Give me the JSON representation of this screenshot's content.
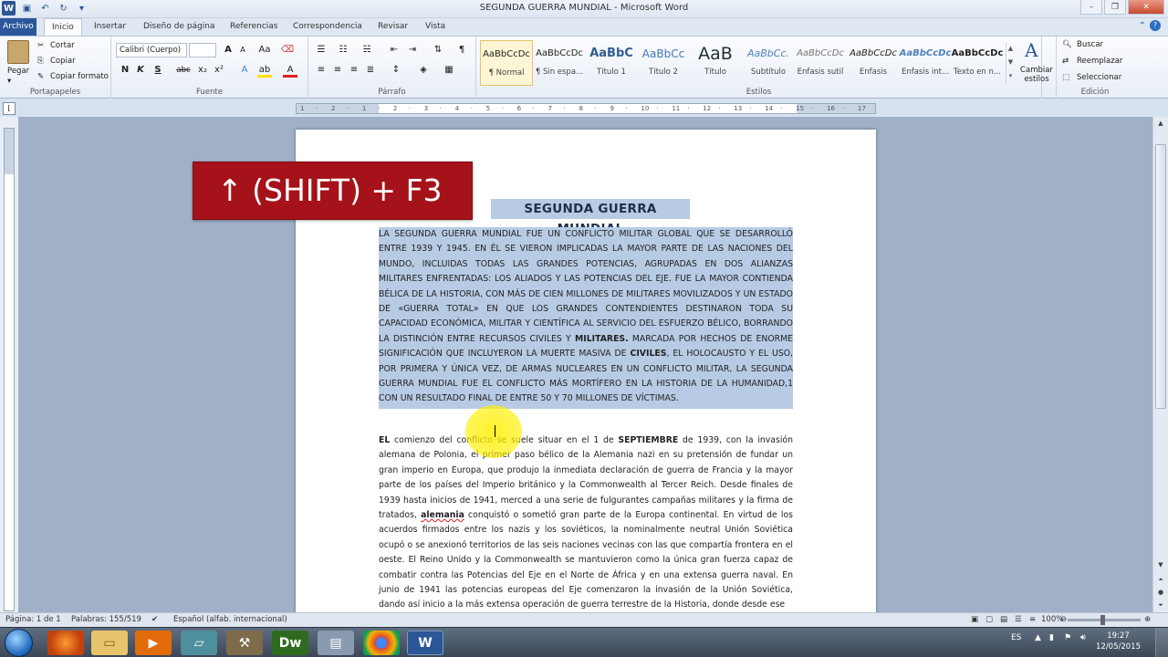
{
  "window": {
    "title": "SEGUNDA GUERRA MUNDIAL  -  Microsoft Word"
  },
  "tabs": [
    "Archivo",
    "Inicio",
    "Insertar",
    "Diseño de página",
    "Referencias",
    "Correspondencia",
    "Revisar",
    "Vista"
  ],
  "ribbon": {
    "clipboard": {
      "paste": "Pegar",
      "cut": "Cortar",
      "copy": "Copiar",
      "format_painter": "Copiar formato",
      "label": "Portapapeles"
    },
    "font": {
      "name": "Calibri (Cuerpo)",
      "size": "",
      "label": "Fuente",
      "grow": "A",
      "shrink": "A",
      "case": "Aa",
      "bold": "N",
      "italic": "K",
      "underline": "S",
      "strike": "abc",
      "sub": "x₂",
      "sup": "x²"
    },
    "paragraph": {
      "label": "Párrafo"
    },
    "styles": {
      "label": "Estilos",
      "items": [
        {
          "preview": "AaBbCcDc",
          "name": "¶ Normal"
        },
        {
          "preview": "AaBbCcDc",
          "name": "¶ Sin espa..."
        },
        {
          "preview": "AaBbC",
          "name": "Título 1"
        },
        {
          "preview": "AaBbCc",
          "name": "Título 2"
        },
        {
          "preview": "AaB",
          "name": "Título"
        },
        {
          "preview": "AaBbCc.",
          "name": "Subtítulo"
        },
        {
          "preview": "AaBbCcDc",
          "name": "Énfasis sutil"
        },
        {
          "preview": "AaBbCcDc",
          "name": "Énfasis"
        },
        {
          "preview": "AaBbCcDc",
          "name": "Énfasis int..."
        },
        {
          "preview": "AaBbCcDc",
          "name": "Texto en n..."
        }
      ],
      "change": "Cambiar estilos"
    },
    "editing": {
      "label": "Edición",
      "find": "Buscar",
      "replace": "Reemplazar",
      "select": "Seleccionar"
    }
  },
  "ruler": {
    "ticks": [
      "1",
      "·",
      "2",
      "·",
      "1",
      "·",
      "2",
      "·",
      "3",
      "·",
      "4",
      "·",
      "5",
      "·",
      "6",
      "·",
      "7",
      "·",
      "8",
      "·",
      "9",
      "·",
      "10",
      "·",
      "11",
      "·",
      "12",
      "·",
      "13",
      "·",
      "14",
      "·",
      "15",
      "·",
      "16",
      "·",
      "17"
    ]
  },
  "overlay": {
    "text": "↑ (SHIFT) + F3"
  },
  "document": {
    "title": "SEGUNDA GUERRA MUNDIAL",
    "p1": [
      {
        "t": "LA SEGUNDA GUERRA MUNDIAL FUE UN CONFLICTO MILITAR GLOBAL QUE SE DESARROLLÓ ENTRE 1939 Y 1945. EN ÉL SE VIERON IMPLICADAS LA MAYOR PARTE DE LAS NACIONES DEL MUNDO, INCLUIDAS TODAS LAS GRANDES POTENCIAS, AGRUPADAS EN DOS ALIANZAS MILITARES ENFRENTADAS: LOS ALIADOS Y LAS POTENCIAS DEL EJE. FUE LA MAYOR CONTIENDA BÉLICA DE LA HISTORIA, CON MÁS DE CIEN MILLONES DE MILITARES MOVILIZADOS Y UN ESTADO DE «GUERRA TOTAL» EN QUE LOS GRANDES CONTENDIENTES DESTINARON TODA SU CAPACIDAD ECONÓMICA, MILITAR Y CIENTÍFICA AL SERVICIO DEL ESFUERZO BÉLICO, BORRANDO LA DISTINCIÓN ENTRE RECURSOS CIVILES Y "
      },
      {
        "t": "MILITARES.",
        "b": true
      },
      {
        "t": " MARCADA POR HECHOS DE ENORME SIGNIFICACIÓN QUE INCLUYERON LA MUERTE MASIVA DE "
      },
      {
        "t": "CIVILES",
        "b": true
      },
      {
        "t": ", EL HOLOCAUSTO Y EL USO, POR PRIMERA Y ÚNICA VEZ, DE ARMAS NUCLEARES EN UN CONFLICTO MILITAR, LA SEGUNDA GUERRA MUNDIAL FUE EL CONFLICTO MÁS MORTÍFERO EN LA HISTORIA DE LA HUMANIDAD,1 CON UN RESULTADO FINAL DE ENTRE 50 Y 70 MILLONES DE VÍCTIMAS."
      }
    ],
    "p2": [
      {
        "t": "EL",
        "b": true
      },
      {
        "t": " comienzo del conflicto se suele situar en el 1 de "
      },
      {
        "t": "SEPTIEMBRE",
        "b": true
      },
      {
        "t": " de 1939, con la invasión alemana de Polonia, el primer paso bélico de la Alemania nazi en su pretensión de fundar un gran imperio en Europa, que produjo la inmediata declaración de guerra de Francia y la mayor parte de los países del Imperio británico y la Commonwealth al Tercer Reich. Desde finales de 1939 hasta inicios de 1941, merced a una serie de fulgurantes campañas militares y la firma de tratados, "
      },
      {
        "t": "alemania",
        "b": true,
        "u": true
      },
      {
        "t": " conquistó o sometió gran parte de la Europa continental. En virtud de los acuerdos firmados entre los nazis y los soviéticos, la nominalmente neutral Unión Soviética ocupó o se anexionó territorios de las seis naciones vecinas con las que compartía frontera en el oeste. El Reino Unido y la Commonwealth se mantuvieron como la única gran fuerza capaz de combatir contra las Potencias del Eje en el Norte de África y en una extensa guerra naval. En junio de 1941 las potencias europeas del Eje comenzaron la invasión de la Unión Soviética, dando así inicio a la más extensa operación de guerra terrestre de la Historia, donde desde ese"
      }
    ]
  },
  "status": {
    "page": "Página: 1 de 1",
    "words": "Palabras: 155/519",
    "lang": "Español (alfab. internacional)",
    "zoom": "100%"
  },
  "taskbar": {
    "lang": "ES",
    "time": "19:27",
    "date": "12/05/2015"
  }
}
